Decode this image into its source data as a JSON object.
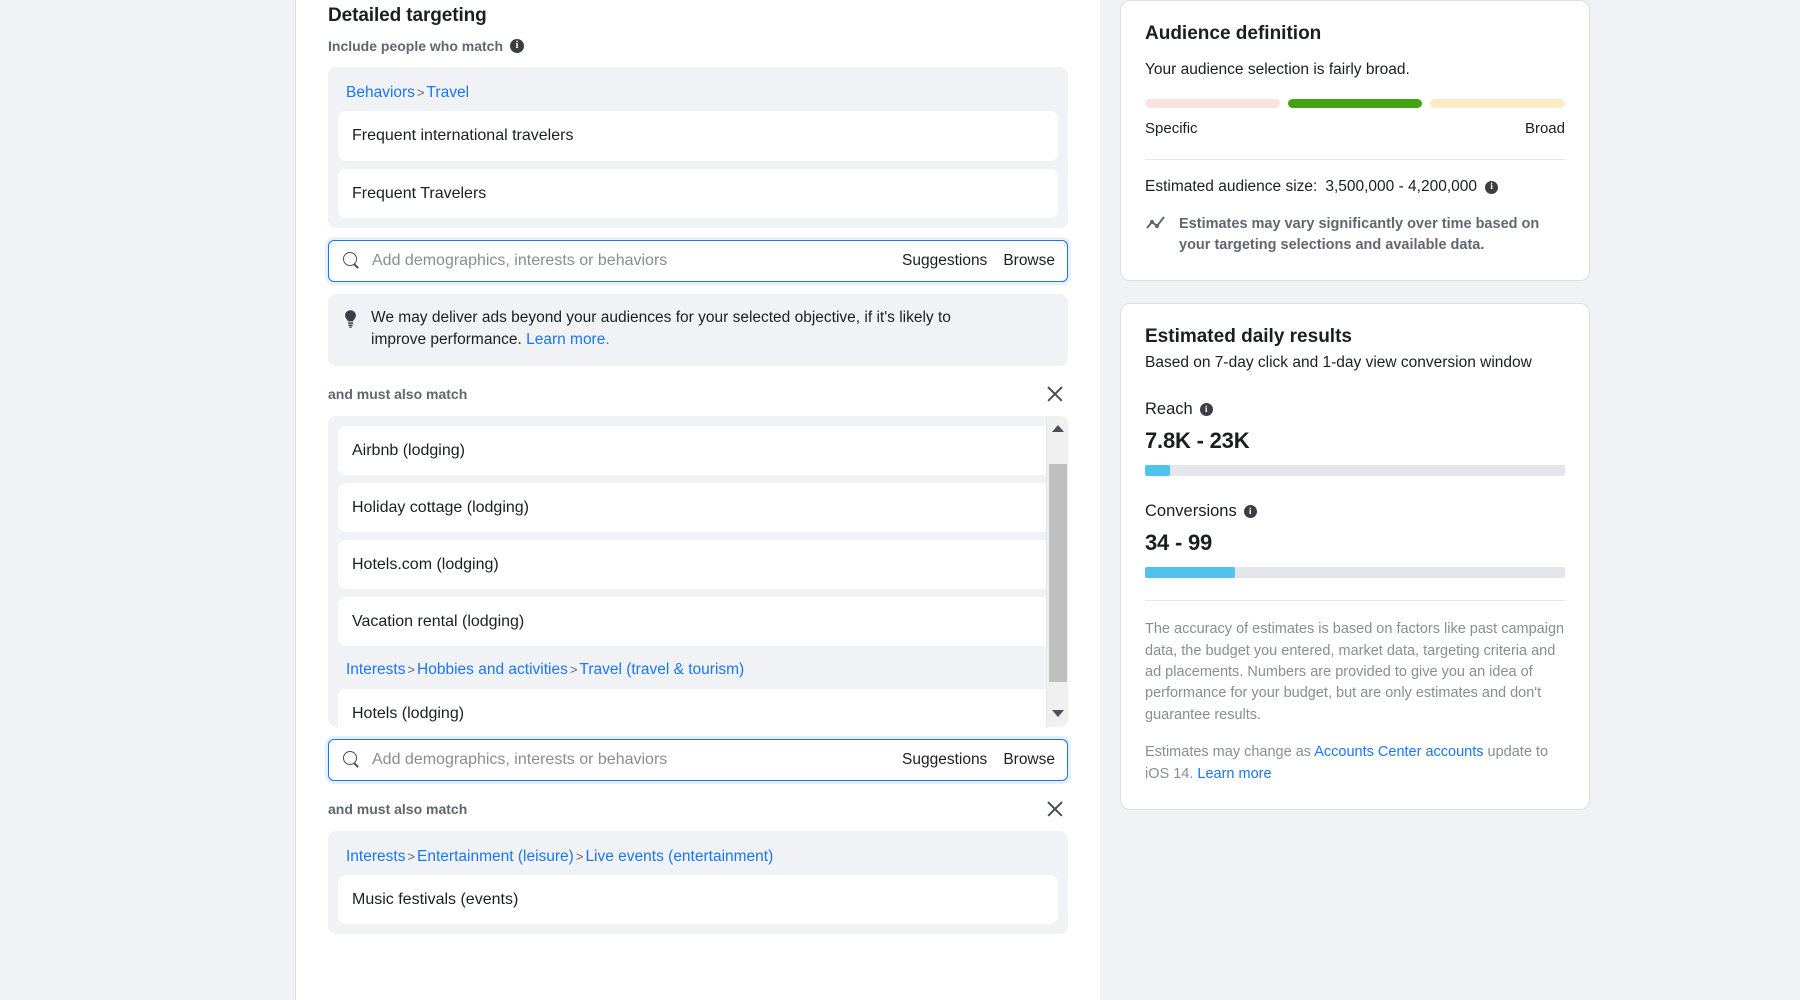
{
  "main": {
    "section_title": "Detailed targeting",
    "include_label": "Include people who match",
    "info_icon": "info-icon",
    "group1": {
      "crumb": [
        {
          "text": "Behaviors",
          "link": true
        },
        {
          "text": ">",
          "link": false
        },
        {
          "text": "Travel",
          "link": true
        }
      ],
      "items": [
        "Frequent international travelers",
        "Frequent Travelers"
      ]
    },
    "search1": {
      "placeholder": "Add demographics, interests or behaviors",
      "value": "",
      "suggestions_label": "Suggestions",
      "browse_label": "Browse",
      "search_icon": "search-icon"
    },
    "tip": {
      "icon": "lightbulb-icon",
      "text": "We may deliver ads beyond your audiences for your selected objective, if it's likely to improve performance.",
      "link": "Learn more."
    },
    "also_match_1": {
      "label": "and must also match",
      "close_icon": "close-icon"
    },
    "group2": {
      "items": [
        "Airbnb (lodging)",
        "Holiday cottage (lodging)",
        "Hotels.com (lodging)",
        "Vacation rental (lodging)"
      ],
      "crumb": [
        {
          "text": "Interests",
          "link": true
        },
        {
          "text": ">",
          "link": false
        },
        {
          "text": "Hobbies and activities",
          "link": true
        },
        {
          "text": ">",
          "link": false
        },
        {
          "text": "Travel (travel & tourism)",
          "link": true
        }
      ],
      "items2": [
        "Hotels (lodging)"
      ],
      "scrollbar": {
        "up_icon": "scroll-up-arrow-icon",
        "down_icon": "scroll-down-arrow-icon",
        "thumb": "scrollbar-thumb"
      }
    },
    "search2": {
      "placeholder": "Add demographics, interests or behaviors",
      "value": "",
      "suggestions_label": "Suggestions",
      "browse_label": "Browse",
      "search_icon": "search-icon"
    },
    "also_match_2": {
      "label": "and must also match",
      "close_icon": "close-icon"
    },
    "group3": {
      "crumb": [
        {
          "text": "Interests",
          "link": true
        },
        {
          "text": ">",
          "link": false
        },
        {
          "text": "Entertainment (leisure)",
          "link": true
        },
        {
          "text": ">",
          "link": false
        },
        {
          "text": "Live events (entertainment)",
          "link": true
        }
      ],
      "items": [
        "Music festivals (events)"
      ]
    }
  },
  "audience_card": {
    "title": "Audience definition",
    "subtitle": "Your audience selection is fairly broad.",
    "gauge": {
      "segments": [
        {
          "name": "specific",
          "color": "#fbe3e0"
        },
        {
          "name": "balanced",
          "color": "#42a412"
        },
        {
          "name": "broad",
          "color": "#fbecc6"
        }
      ],
      "left_label": "Specific",
      "right_label": "Broad"
    },
    "estimated_size_label": "Estimated audience size:",
    "estimated_size_value": "3,500,000 - 4,200,000",
    "info_icon": "info-icon",
    "note_icon": "trend-line-icon",
    "note": "Estimates may vary significantly over time based on your targeting selections and available data."
  },
  "results_card": {
    "title": "Estimated daily results",
    "subtitle": "Based on 7-day click and 1-day view conversion window",
    "metrics": [
      {
        "label": "Reach",
        "value": "7.8K - 23K",
        "fill_pct": 6,
        "info_icon": "info-icon",
        "bar_color": "#4ec3ec"
      },
      {
        "label": "Conversions",
        "value": "34 - 99",
        "fill_pct": 21.5,
        "info_icon": "info-icon",
        "bar_color": "#4ec3ec"
      }
    ],
    "disclaimer": "The accuracy of estimates is based on factors like past campaign data, the budget you entered, market data, targeting criteria and ad placements. Numbers are provided to give you an idea of performance for your budget, but are only estimates and don't guarantee results.",
    "ios_prefix": "Estimates may change as ",
    "ios_link1": "Accounts Center accounts",
    "ios_mid": " update to iOS 14. ",
    "ios_link2": "Learn more"
  }
}
